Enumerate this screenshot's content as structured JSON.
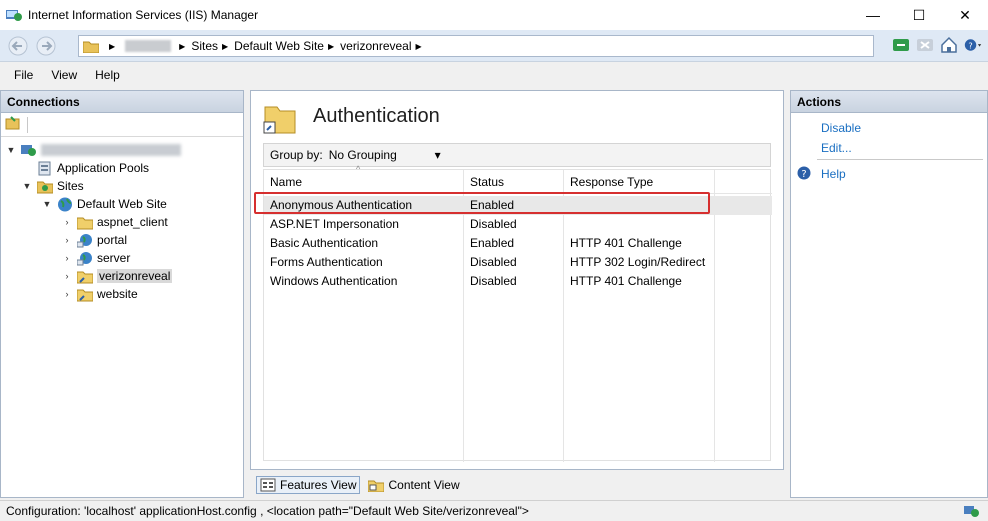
{
  "window": {
    "title": "Internet Information Services (IIS) Manager",
    "minimize": "—",
    "maximize": "☐",
    "close": "✕"
  },
  "address": {
    "crumbs": [
      "Sites",
      "Default Web Site",
      "verizonreveal"
    ]
  },
  "menu": [
    "File",
    "View",
    "Help"
  ],
  "connections": {
    "header": "Connections",
    "tree": {
      "app_pools": "Application Pools",
      "sites": "Sites",
      "default_site": "Default Web Site",
      "children": [
        "aspnet_client",
        "portal",
        "server",
        "verizonreveal",
        "website"
      ]
    }
  },
  "feature": {
    "title": "Authentication",
    "group_by_label": "Group by:",
    "group_by_value": "No Grouping",
    "columns": [
      "Name",
      "Status",
      "Response Type"
    ],
    "rows": [
      {
        "name": "Anonymous Authentication",
        "status": "Enabled",
        "response": ""
      },
      {
        "name": "ASP.NET Impersonation",
        "status": "Disabled",
        "response": ""
      },
      {
        "name": "Basic Authentication",
        "status": "Enabled",
        "response": "HTTP 401 Challenge"
      },
      {
        "name": "Forms Authentication",
        "status": "Disabled",
        "response": "HTTP 302 Login/Redirect"
      },
      {
        "name": "Windows Authentication",
        "status": "Disabled",
        "response": "HTTP 401 Challenge"
      }
    ]
  },
  "views": {
    "features": "Features View",
    "content": "Content View"
  },
  "actions": {
    "header": "Actions",
    "disable": "Disable",
    "edit": "Edit...",
    "help": "Help"
  },
  "status": {
    "text": "Configuration: 'localhost' applicationHost.config , <location path=\"Default Web Site/verizonreveal\">"
  },
  "colors": {
    "highlight_box": "#d62f2f",
    "action_link": "#1a6fc2",
    "panel_header": "#c9d3e0"
  }
}
